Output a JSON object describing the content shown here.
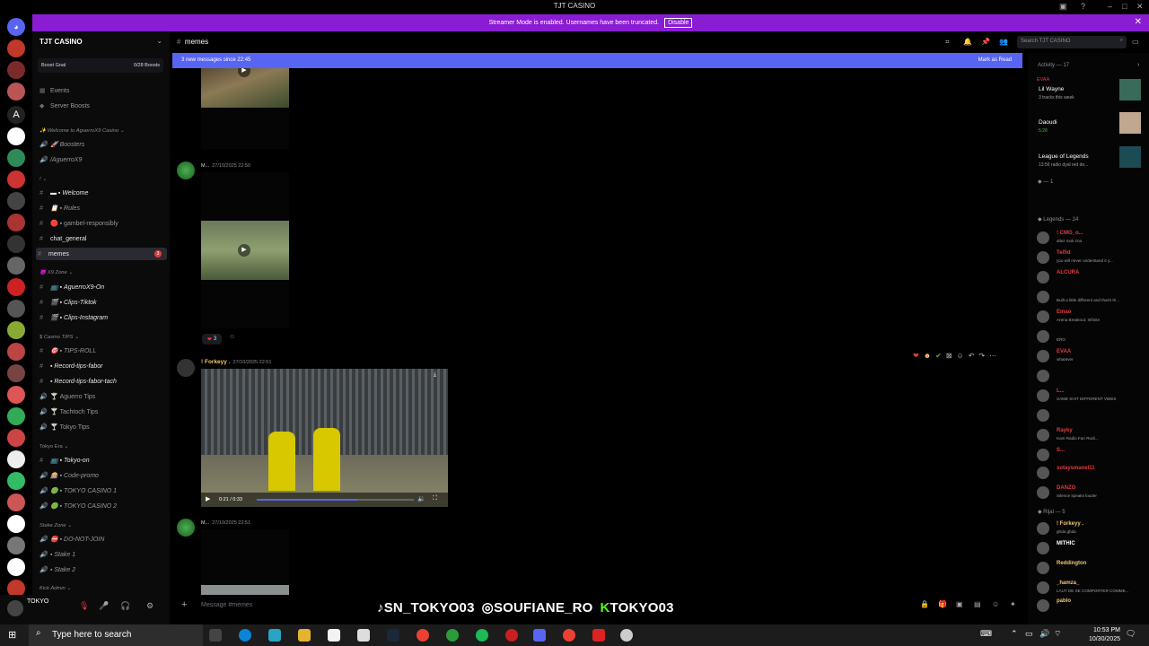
{
  "app": {
    "title": "TJT CASINO"
  },
  "banner": {
    "text": "Streamer Mode is enabled. Usernames have been truncated.",
    "disable_label": "Disable"
  },
  "sidebar": {
    "server_name": "TJT CASINO",
    "boost_goal": "Boost Goal",
    "boost_count": "0/28 Boosts",
    "items": [
      {
        "label": "Events",
        "icon": "calendar-icon"
      },
      {
        "label": "Server Boosts",
        "icon": "boost-icon"
      }
    ],
    "categories": [
      {
        "label": "Welcome to AguerroX9 Casino"
      },
      {
        "label": "X9 Zone"
      },
      {
        "label": "Casino TIPS"
      },
      {
        "label": "Tokyo Era"
      },
      {
        "label": "Stake Zone"
      },
      {
        "label": "Kick Admin"
      }
    ],
    "channels": [
      {
        "label": "Boosters"
      },
      {
        "label": "/AguerroX9"
      },
      {
        "label": "Welcome"
      },
      {
        "label": "Rules"
      },
      {
        "label": "gambel-responsibly"
      },
      {
        "label": "chat_general"
      },
      {
        "label": "memes",
        "badge": "3"
      },
      {
        "label": "AguerroX9-On"
      },
      {
        "label": "Clips-Tiktok"
      },
      {
        "label": "Clips-Instagram"
      },
      {
        "label": "TIPS-ROLL"
      },
      {
        "label": "Record-tips-fabor"
      },
      {
        "label": "Record-tips-fabor-tach"
      },
      {
        "label": "Aguerro Tips"
      },
      {
        "label": "Tachtoch Tips"
      },
      {
        "label": "Tokyo Tips"
      },
      {
        "label": "Tokyo-on"
      },
      {
        "label": "Code-promo"
      },
      {
        "label": "TOKYO CASINO 1"
      },
      {
        "label": "TOKYO CASINO 2"
      },
      {
        "label": "DO-NOT-JOIN"
      },
      {
        "label": "Stake 1"
      },
      {
        "label": "Stake 2"
      }
    ],
    "user": "TOKYO"
  },
  "header": {
    "channel": "memes",
    "search_placeholder": "Search TJT CASINO"
  },
  "newbar": {
    "text": "3 new messages since 22:45",
    "mark_read": "Mark as Read"
  },
  "messages": [
    {
      "author": "M...",
      "time": "27/10/2025 22:50"
    },
    {
      "author": "! Forkeyy .",
      "time": "27/10/2025 22:51"
    },
    {
      "author": "M...",
      "time": "27/10/2025 22:51"
    }
  ],
  "reaction": {
    "emoji": "❤",
    "count": "3"
  },
  "video": {
    "time": "0:21 / 0:33",
    "progress": 0.64
  },
  "composer": {
    "placeholder": "Message #memes"
  },
  "overlay": {
    "tiktok": "SN_TOKYO03",
    "instagram": "SOUFIANE_RO",
    "kick": "TOKYO03"
  },
  "activity": {
    "title": "Activity — 17",
    "cards": [
      {
        "label": "EVAA",
        "name": "Lil Wayne",
        "sub": "3 tracks this week"
      },
      {
        "label": "Daoudi",
        "sub": "5:28"
      },
      {
        "name": "League of Legends",
        "sub": "13:56 radio dyal red de..."
      }
    ],
    "group1": "1",
    "group2": "Legends — 14",
    "group3": "Rijal — 5",
    "members": [
      {
        "name": "! CMG_o...",
        "status": "allez mok zna",
        "color": "#e23b3b"
      },
      {
        "name": "Telfid",
        "status": "you will never understand it y...",
        "color": "#e23b3b"
      },
      {
        "name": "ALCURA",
        "status": "",
        "color": "#e23b3b"
      },
      {
        "name": "",
        "status": "Built a little different and that's th...",
        "color": "#e23b3b"
      },
      {
        "name": "Emao",
        "status": "Arena Breakout: Infinite",
        "color": "#e23b3b"
      },
      {
        "name": "",
        "status": "ERO",
        "color": "#e23b3b"
      },
      {
        "name": "EVAA",
        "status": "whatever",
        "color": "#e23b3b"
      },
      {
        "name": "",
        "status": "",
        "color": "#e23b3b"
      },
      {
        "name": "L...",
        "status": "SAME SHIT DIFFERENT VIBES",
        "color": "#e23b3b"
      },
      {
        "name": "",
        "status": "",
        "color": "#e23b3b"
      },
      {
        "name": "Rayky",
        "status": "Kam Radio Fan Rodi...",
        "color": "#e23b3b"
      },
      {
        "name": "S...",
        "status": "",
        "color": "#e23b3b"
      },
      {
        "name": "sotaysmanel11",
        "status": "",
        "color": "#e23b3b"
      },
      {
        "name": "DANZO",
        "status": "Silence speaks louder",
        "color": "#e23b3b"
      },
      {
        "name": "! Forkeyy .",
        "status": "ghda ghda",
        "color": "#f0c674"
      },
      {
        "name": "MITHIC",
        "status": "",
        "color": "#fff"
      },
      {
        "name": "Reddington",
        "status": "",
        "color": "#f0c674"
      },
      {
        "name": "_hamza_",
        "status": "LAUT DE SE COMPORTER COMME...",
        "color": "#f0c674"
      },
      {
        "name": "pablo",
        "status": "",
        "color": "#f0c674"
      }
    ]
  },
  "taskbar": {
    "search": "Type here to search",
    "time": "10:53 PM",
    "date": "10/30/2025"
  }
}
